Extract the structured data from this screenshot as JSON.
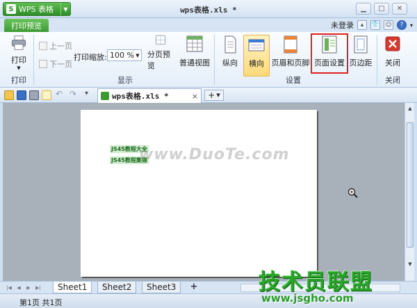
{
  "app": {
    "name": "WPS 表格",
    "logo": "S",
    "window_title": "wps表格.xls *"
  },
  "tabs": {
    "print_preview": "打印预览"
  },
  "user": {
    "login": "未登录"
  },
  "ribbon": {
    "print": {
      "label": "打印",
      "group": "打印"
    },
    "prev_page": "上一页",
    "next_page": "下一页",
    "zoom_label": "打印缩放:",
    "zoom_value": "100 %",
    "page_break_preview": "分页预览",
    "normal_view": "普通视图",
    "display_group": "显示",
    "portrait": "纵向",
    "landscape": "横向",
    "header_footer": "页眉和页脚",
    "page_setup": "页面设置",
    "margins": "页边距",
    "settings_group": "设置",
    "close": "关闭",
    "close_group": "关闭"
  },
  "document_tab": {
    "name": "wps表格.xls *",
    "close": "×",
    "add": "+"
  },
  "page": {
    "cells": [
      "JS45教程大全",
      "JS45教程集锦"
    ],
    "watermark": "www.DuoTe.com"
  },
  "sheets": [
    "Sheet1",
    "Sheet2",
    "Sheet3"
  ],
  "add_sheet": "+",
  "status": {
    "page_info": "第1页 共1页"
  },
  "brand": {
    "title": "技术员联盟",
    "url": "www.jsgho.com"
  },
  "colors": {
    "accent_green": "#3c9a34",
    "highlight_red": "#e02020"
  }
}
